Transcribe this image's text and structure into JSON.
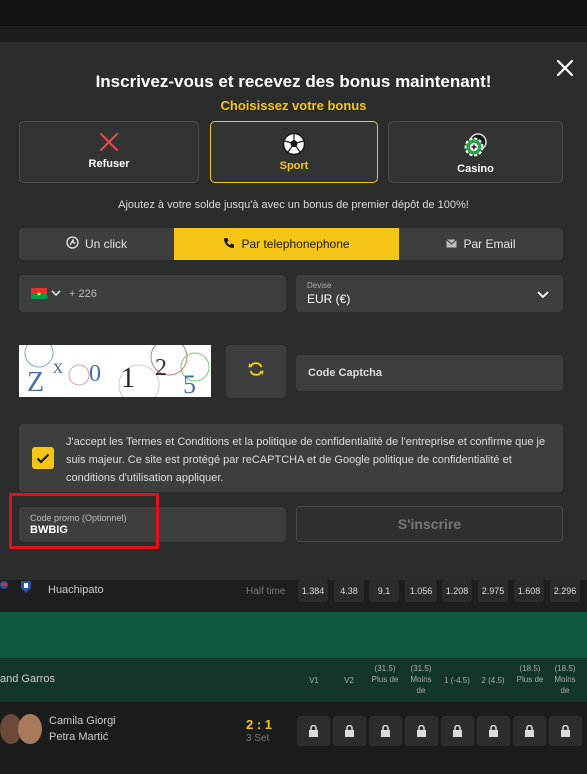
{
  "modal": {
    "title": "Inscrivez-vous et recevez des bonus maintenant!",
    "subtitle": "Choisissez votre bonus",
    "close_icon": "close-icon",
    "bonus_options": [
      {
        "label": "Refuser",
        "icon": "x-icon",
        "selected": false
      },
      {
        "label": "Sport",
        "icon": "soccer-ball-icon",
        "selected": true
      },
      {
        "label": "Casino",
        "icon": "casino-chip-icon",
        "selected": false
      }
    ],
    "bonus_info": "Ajoutez à votre solde jusqu'à avec un bonus de premier dépôt de 100%!",
    "tabs": [
      {
        "label": "Un click",
        "icon": "one-click-icon",
        "active": false
      },
      {
        "label": "Par telephonephone",
        "icon": "phone-icon",
        "active": true
      },
      {
        "label": "Par Email",
        "icon": "email-icon",
        "active": false
      }
    ],
    "phone": {
      "country_code": "+ 226",
      "flag": "burkina-faso-flag-icon"
    },
    "currency": {
      "label": "Devise",
      "value": "EUR (€)"
    },
    "captcha": {
      "characters": "ZX0125",
      "placeholder": "Code Captcha"
    },
    "terms": {
      "checked": true,
      "text": "J'accept les Termes et Conditions et la politique de confidentialité de l'entreprise et confirme que je suis majeur. Ce site est protégé par reCAPTCHA et de Google politique de confidentialité et conditions d'utilisation appliquer."
    },
    "promo": {
      "label": "Code promo (Optionnel)",
      "value": "BWBIG"
    },
    "submit_label": "S'inscrire",
    "colors": {
      "accent": "#f5c518",
      "highlight": "#e0101f",
      "panel": "#2b2d2d",
      "field": "#3d3f3f"
    }
  },
  "background": {
    "match1": {
      "team": "Huachipato",
      "score_label": "Half time",
      "odds": [
        "1.384",
        "4.38",
        "9.1",
        "1.056",
        "1.208",
        "2.975",
        "1.608",
        "2.296"
      ]
    },
    "tournament": "and Garros",
    "headers": [
      "V1",
      "V2",
      "(31.5) Plus de",
      "(31.5) Moins de",
      "1 (-4.5)",
      "2 (4.5)",
      "(18.5) Plus de",
      "(18.5) Moins de"
    ],
    "match2": {
      "player1": "Camila Giorgi",
      "player2": "Petra Martić",
      "score": "2 : 1",
      "set": "3 Set"
    }
  }
}
